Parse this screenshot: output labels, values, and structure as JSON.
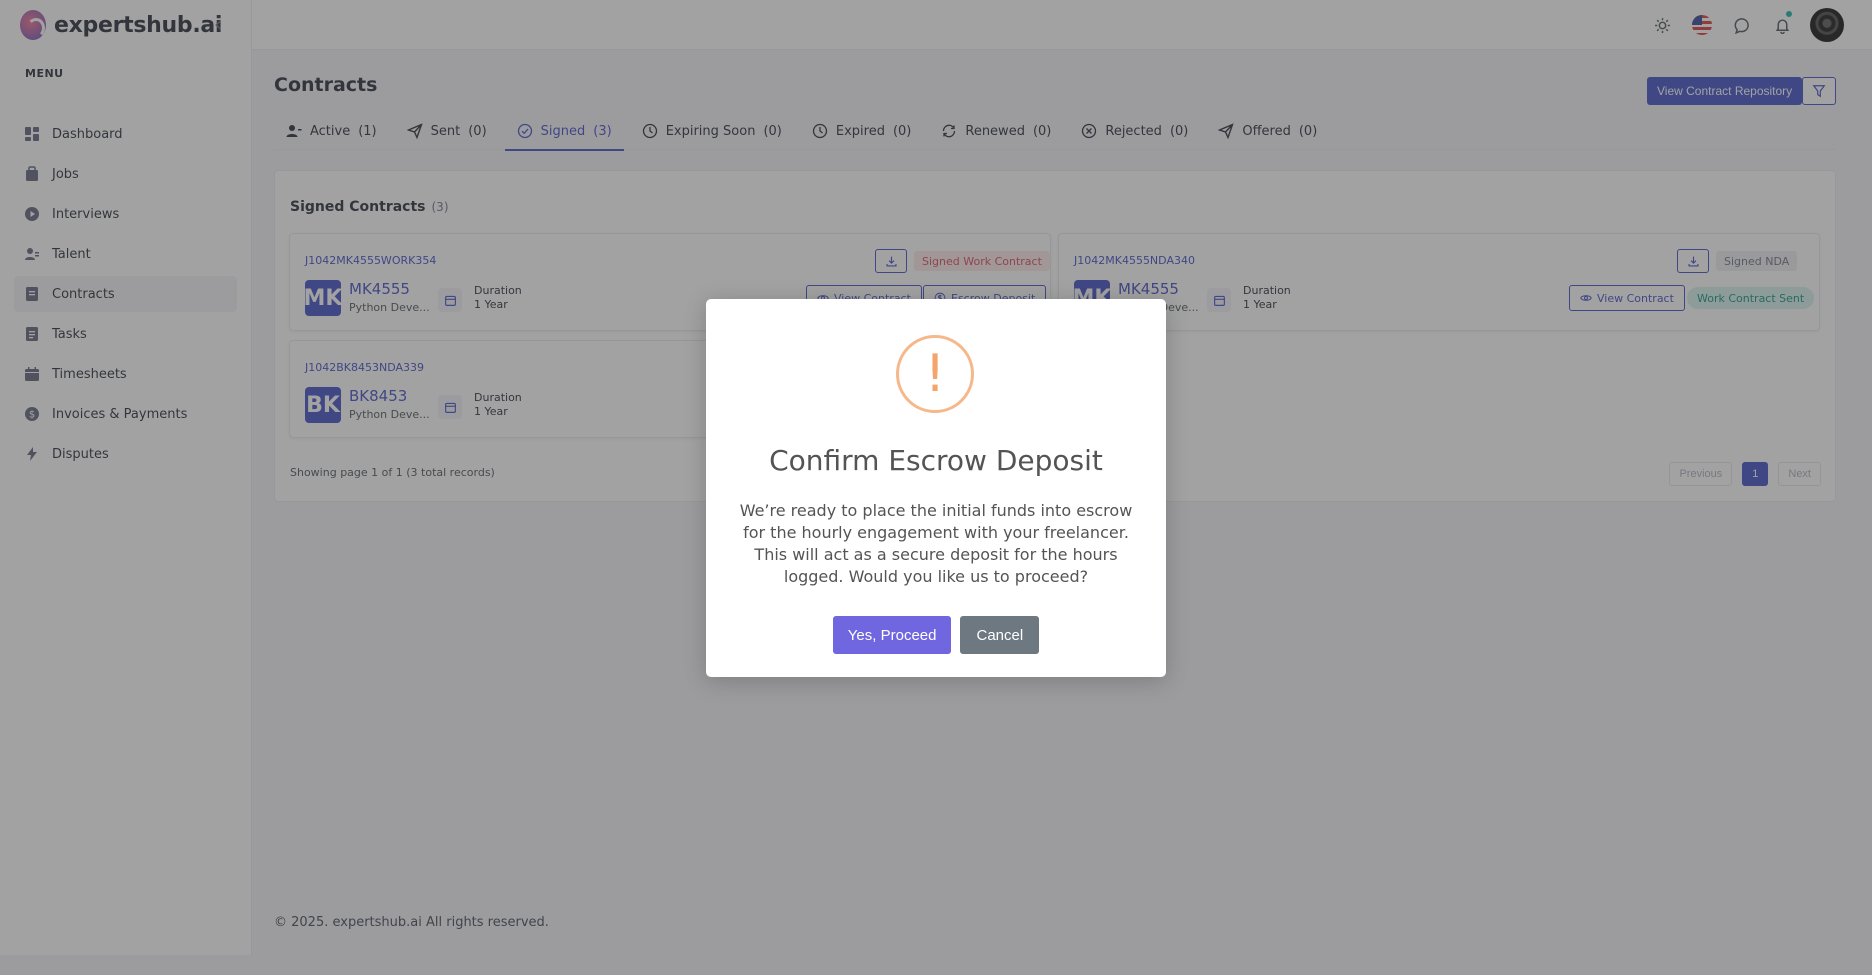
{
  "brand": {
    "name": "expertshub.ai"
  },
  "sidebar": {
    "menu_title": "MENU",
    "items": [
      {
        "label": "Dashboard",
        "icon": "dashboard-icon"
      },
      {
        "label": "Jobs",
        "icon": "briefcase-icon"
      },
      {
        "label": "Interviews",
        "icon": "play-circle-icon"
      },
      {
        "label": "Talent",
        "icon": "users-icon"
      },
      {
        "label": "Contracts",
        "icon": "file-icon",
        "active": true
      },
      {
        "label": "Tasks",
        "icon": "task-icon"
      },
      {
        "label": "Timesheets",
        "icon": "calendar-icon"
      },
      {
        "label": "Invoices & Payments",
        "icon": "dollar-circle-icon"
      },
      {
        "label": "Disputes",
        "icon": "flash-icon"
      }
    ]
  },
  "header": {
    "icons": [
      "sun-icon",
      "us-flag-icon",
      "chat-icon",
      "bell-icon",
      "avatar"
    ]
  },
  "page": {
    "title": "Contracts",
    "repo_button": "View Contract Repository",
    "tabs": [
      {
        "label": "Active",
        "count": "(1)",
        "icon": "user-icon"
      },
      {
        "label": "Sent",
        "count": "(0)",
        "icon": "send-icon"
      },
      {
        "label": "Signed",
        "count": "(3)",
        "icon": "check-circle-icon",
        "active": true
      },
      {
        "label": "Expiring Soon",
        "count": "(0)",
        "icon": "clock-icon"
      },
      {
        "label": "Expired",
        "count": "(0)",
        "icon": "clock-icon"
      },
      {
        "label": "Renewed",
        "count": "(0)",
        "icon": "refresh-icon"
      },
      {
        "label": "Rejected",
        "count": "(0)",
        "icon": "x-circle-icon"
      },
      {
        "label": "Offered",
        "count": "(0)",
        "icon": "send-icon"
      }
    ]
  },
  "panel": {
    "title": "Signed Contracts",
    "count": "(3)",
    "records": "Showing page 1 of 1 (3 total records)",
    "pager": {
      "previous": "Previous",
      "page": "1",
      "next": "Next"
    }
  },
  "cards": [
    {
      "id": "J1042MK4555WORK354",
      "initials": "MK",
      "name": "MK4555",
      "role": "Python Deve...",
      "duration_label": "Duration",
      "duration_value": "1 Year",
      "badge": "Signed Work Contract",
      "btn_view": "View Contract",
      "btn_escrow": "Escrow Deposit"
    },
    {
      "id": "J1042MK4555NDA340",
      "initials": "MK",
      "name": "MK4555",
      "role": "Python Deve...",
      "duration_label": "Duration",
      "duration_value": "1 Year",
      "badge": "Signed NDA",
      "btn_view": "View Contract",
      "status": "Work Contract Sent"
    },
    {
      "id": "J1042BK8453NDA339",
      "initials": "BK",
      "name": "BK8453",
      "role": "Python Deve...",
      "duration_label": "Duration",
      "duration_value": "1 Year"
    }
  ],
  "footer": {
    "text": "© 2025. expertshub.ai All rights reserved."
  },
  "modal": {
    "icon": "!",
    "title": "Confirm Escrow Deposit",
    "text": "We’re ready to place the initial funds into escrow for the hourly engagement with your freelancer. This will act as a secure deposit for the hours logged. Would you like us to proceed?",
    "confirm": "Yes, Proceed",
    "cancel": "Cancel"
  }
}
